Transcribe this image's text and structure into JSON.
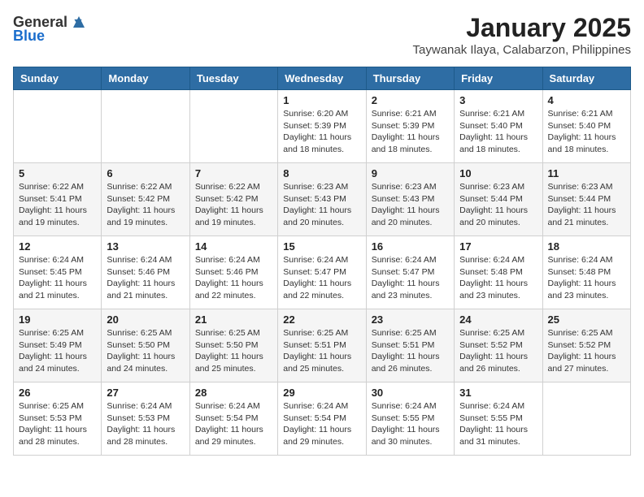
{
  "logo": {
    "general": "General",
    "blue": "Blue"
  },
  "title": "January 2025",
  "subtitle": "Taywanak Ilaya, Calabarzon, Philippines",
  "weekdays": [
    "Sunday",
    "Monday",
    "Tuesday",
    "Wednesday",
    "Thursday",
    "Friday",
    "Saturday"
  ],
  "weeks": [
    [
      {
        "day": "",
        "sunrise": "",
        "sunset": "",
        "daylight": ""
      },
      {
        "day": "",
        "sunrise": "",
        "sunset": "",
        "daylight": ""
      },
      {
        "day": "",
        "sunrise": "",
        "sunset": "",
        "daylight": ""
      },
      {
        "day": "1",
        "sunrise": "Sunrise: 6:20 AM",
        "sunset": "Sunset: 5:39 PM",
        "daylight": "Daylight: 11 hours and 18 minutes."
      },
      {
        "day": "2",
        "sunrise": "Sunrise: 6:21 AM",
        "sunset": "Sunset: 5:39 PM",
        "daylight": "Daylight: 11 hours and 18 minutes."
      },
      {
        "day": "3",
        "sunrise": "Sunrise: 6:21 AM",
        "sunset": "Sunset: 5:40 PM",
        "daylight": "Daylight: 11 hours and 18 minutes."
      },
      {
        "day": "4",
        "sunrise": "Sunrise: 6:21 AM",
        "sunset": "Sunset: 5:40 PM",
        "daylight": "Daylight: 11 hours and 18 minutes."
      }
    ],
    [
      {
        "day": "5",
        "sunrise": "Sunrise: 6:22 AM",
        "sunset": "Sunset: 5:41 PM",
        "daylight": "Daylight: 11 hours and 19 minutes."
      },
      {
        "day": "6",
        "sunrise": "Sunrise: 6:22 AM",
        "sunset": "Sunset: 5:42 PM",
        "daylight": "Daylight: 11 hours and 19 minutes."
      },
      {
        "day": "7",
        "sunrise": "Sunrise: 6:22 AM",
        "sunset": "Sunset: 5:42 PM",
        "daylight": "Daylight: 11 hours and 19 minutes."
      },
      {
        "day": "8",
        "sunrise": "Sunrise: 6:23 AM",
        "sunset": "Sunset: 5:43 PM",
        "daylight": "Daylight: 11 hours and 20 minutes."
      },
      {
        "day": "9",
        "sunrise": "Sunrise: 6:23 AM",
        "sunset": "Sunset: 5:43 PM",
        "daylight": "Daylight: 11 hours and 20 minutes."
      },
      {
        "day": "10",
        "sunrise": "Sunrise: 6:23 AM",
        "sunset": "Sunset: 5:44 PM",
        "daylight": "Daylight: 11 hours and 20 minutes."
      },
      {
        "day": "11",
        "sunrise": "Sunrise: 6:23 AM",
        "sunset": "Sunset: 5:44 PM",
        "daylight": "Daylight: 11 hours and 21 minutes."
      }
    ],
    [
      {
        "day": "12",
        "sunrise": "Sunrise: 6:24 AM",
        "sunset": "Sunset: 5:45 PM",
        "daylight": "Daylight: 11 hours and 21 minutes."
      },
      {
        "day": "13",
        "sunrise": "Sunrise: 6:24 AM",
        "sunset": "Sunset: 5:46 PM",
        "daylight": "Daylight: 11 hours and 21 minutes."
      },
      {
        "day": "14",
        "sunrise": "Sunrise: 6:24 AM",
        "sunset": "Sunset: 5:46 PM",
        "daylight": "Daylight: 11 hours and 22 minutes."
      },
      {
        "day": "15",
        "sunrise": "Sunrise: 6:24 AM",
        "sunset": "Sunset: 5:47 PM",
        "daylight": "Daylight: 11 hours and 22 minutes."
      },
      {
        "day": "16",
        "sunrise": "Sunrise: 6:24 AM",
        "sunset": "Sunset: 5:47 PM",
        "daylight": "Daylight: 11 hours and 23 minutes."
      },
      {
        "day": "17",
        "sunrise": "Sunrise: 6:24 AM",
        "sunset": "Sunset: 5:48 PM",
        "daylight": "Daylight: 11 hours and 23 minutes."
      },
      {
        "day": "18",
        "sunrise": "Sunrise: 6:24 AM",
        "sunset": "Sunset: 5:48 PM",
        "daylight": "Daylight: 11 hours and 23 minutes."
      }
    ],
    [
      {
        "day": "19",
        "sunrise": "Sunrise: 6:25 AM",
        "sunset": "Sunset: 5:49 PM",
        "daylight": "Daylight: 11 hours and 24 minutes."
      },
      {
        "day": "20",
        "sunrise": "Sunrise: 6:25 AM",
        "sunset": "Sunset: 5:50 PM",
        "daylight": "Daylight: 11 hours and 24 minutes."
      },
      {
        "day": "21",
        "sunrise": "Sunrise: 6:25 AM",
        "sunset": "Sunset: 5:50 PM",
        "daylight": "Daylight: 11 hours and 25 minutes."
      },
      {
        "day": "22",
        "sunrise": "Sunrise: 6:25 AM",
        "sunset": "Sunset: 5:51 PM",
        "daylight": "Daylight: 11 hours and 25 minutes."
      },
      {
        "day": "23",
        "sunrise": "Sunrise: 6:25 AM",
        "sunset": "Sunset: 5:51 PM",
        "daylight": "Daylight: 11 hours and 26 minutes."
      },
      {
        "day": "24",
        "sunrise": "Sunrise: 6:25 AM",
        "sunset": "Sunset: 5:52 PM",
        "daylight": "Daylight: 11 hours and 26 minutes."
      },
      {
        "day": "25",
        "sunrise": "Sunrise: 6:25 AM",
        "sunset": "Sunset: 5:52 PM",
        "daylight": "Daylight: 11 hours and 27 minutes."
      }
    ],
    [
      {
        "day": "26",
        "sunrise": "Sunrise: 6:25 AM",
        "sunset": "Sunset: 5:53 PM",
        "daylight": "Daylight: 11 hours and 28 minutes."
      },
      {
        "day": "27",
        "sunrise": "Sunrise: 6:24 AM",
        "sunset": "Sunset: 5:53 PM",
        "daylight": "Daylight: 11 hours and 28 minutes."
      },
      {
        "day": "28",
        "sunrise": "Sunrise: 6:24 AM",
        "sunset": "Sunset: 5:54 PM",
        "daylight": "Daylight: 11 hours and 29 minutes."
      },
      {
        "day": "29",
        "sunrise": "Sunrise: 6:24 AM",
        "sunset": "Sunset: 5:54 PM",
        "daylight": "Daylight: 11 hours and 29 minutes."
      },
      {
        "day": "30",
        "sunrise": "Sunrise: 6:24 AM",
        "sunset": "Sunset: 5:55 PM",
        "daylight": "Daylight: 11 hours and 30 minutes."
      },
      {
        "day": "31",
        "sunrise": "Sunrise: 6:24 AM",
        "sunset": "Sunset: 5:55 PM",
        "daylight": "Daylight: 11 hours and 31 minutes."
      },
      {
        "day": "",
        "sunrise": "",
        "sunset": "",
        "daylight": ""
      }
    ]
  ]
}
